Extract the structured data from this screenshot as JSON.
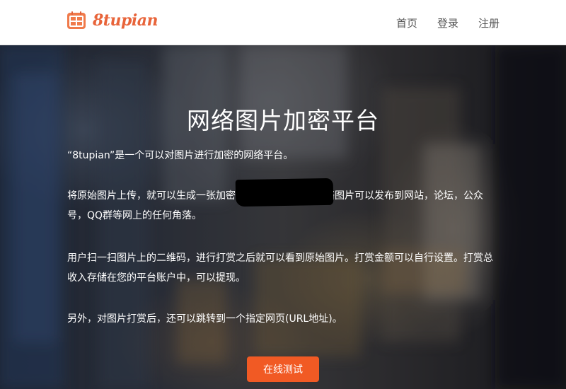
{
  "navbar": {
    "brand_name": "8tupian",
    "links": [
      "首页",
      "登录",
      "注册"
    ]
  },
  "hero": {
    "title": "网络图片加密平台",
    "paragraphs": [
      "“8tupian”是一个可以对图片进行加密的网络平台。",
      "将原始图片上传，就可以生成一张加密的网络图片，这张网络图片可以发布到网站，论坛，公众号，QQ群等网上的任何角落。",
      "用户扫一扫图片上的二维码，进行打赏之后就可以看到原始图片。打赏金额可以自行设置。打赏总收入存储在您的平台账户中，可以提现。",
      "另外，对图片打赏后，还可以跳转到一个指定网页(URL地址)。"
    ],
    "cta_label": "在线测试"
  },
  "colors": {
    "brand": "#e8643a",
    "cta": "#f15a24",
    "nav_text": "#555555"
  },
  "icons": {
    "brand_icon": "grid-card-icon"
  }
}
